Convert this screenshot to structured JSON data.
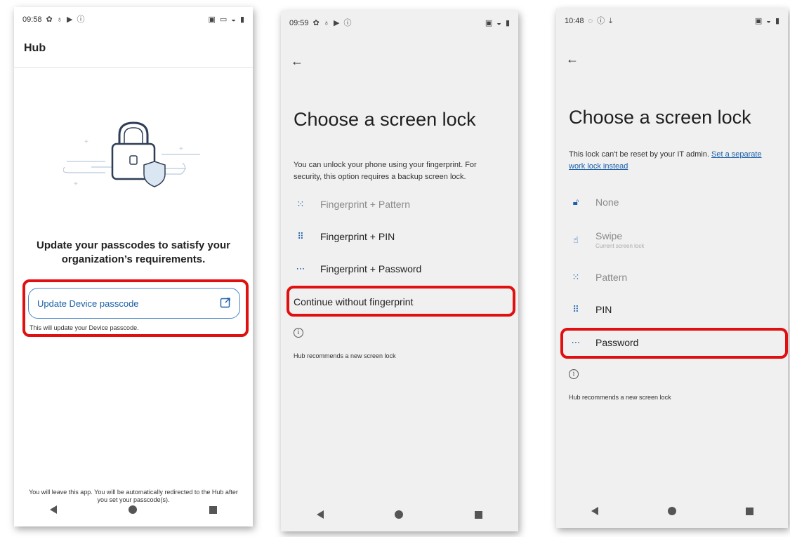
{
  "phone1": {
    "status": {
      "time": "09:58"
    },
    "app_title": "Hub",
    "message": "Update your passcodes to satisfy your organization’s requirements.",
    "update_button_label": "Update Device passcode",
    "update_note": "This will update your Device passcode.",
    "footer": "You will leave this app. You will be automatically redirected to the Hub after you set your passcode(s)."
  },
  "phone2": {
    "status": {
      "time": "09:59"
    },
    "title": "Choose a screen lock",
    "description": "You can unlock your phone using your fingerprint. For security, this option requires a backup screen lock.",
    "options": [
      {
        "label": "Fingerprint + Pattern",
        "icon": "pattern-icon"
      },
      {
        "label": "Fingerprint + PIN",
        "icon": "pin-icon"
      },
      {
        "label": "Fingerprint + Password",
        "icon": "password-icon"
      }
    ],
    "continue_label": "Continue without fingerprint",
    "recommend": "Hub recommends a new screen lock"
  },
  "phone3": {
    "status": {
      "time": "10:48"
    },
    "title": "Choose a screen lock",
    "description": "This lock can't be reset by your IT admin.",
    "link": "Set a separate work lock instead",
    "options": [
      {
        "label": "None",
        "icon": "lock-open-icon"
      },
      {
        "label": "Swipe",
        "sub": "Current screen lock",
        "icon": "swipe-icon"
      },
      {
        "label": "Pattern",
        "icon": "pattern-icon"
      },
      {
        "label": "PIN",
        "icon": "pin-icon"
      },
      {
        "label": "Password",
        "icon": "password-icon"
      }
    ],
    "recommend": "Hub recommends a new screen lock"
  },
  "colors": {
    "highlight": "#e01010",
    "accent": "#1a5fa8"
  }
}
